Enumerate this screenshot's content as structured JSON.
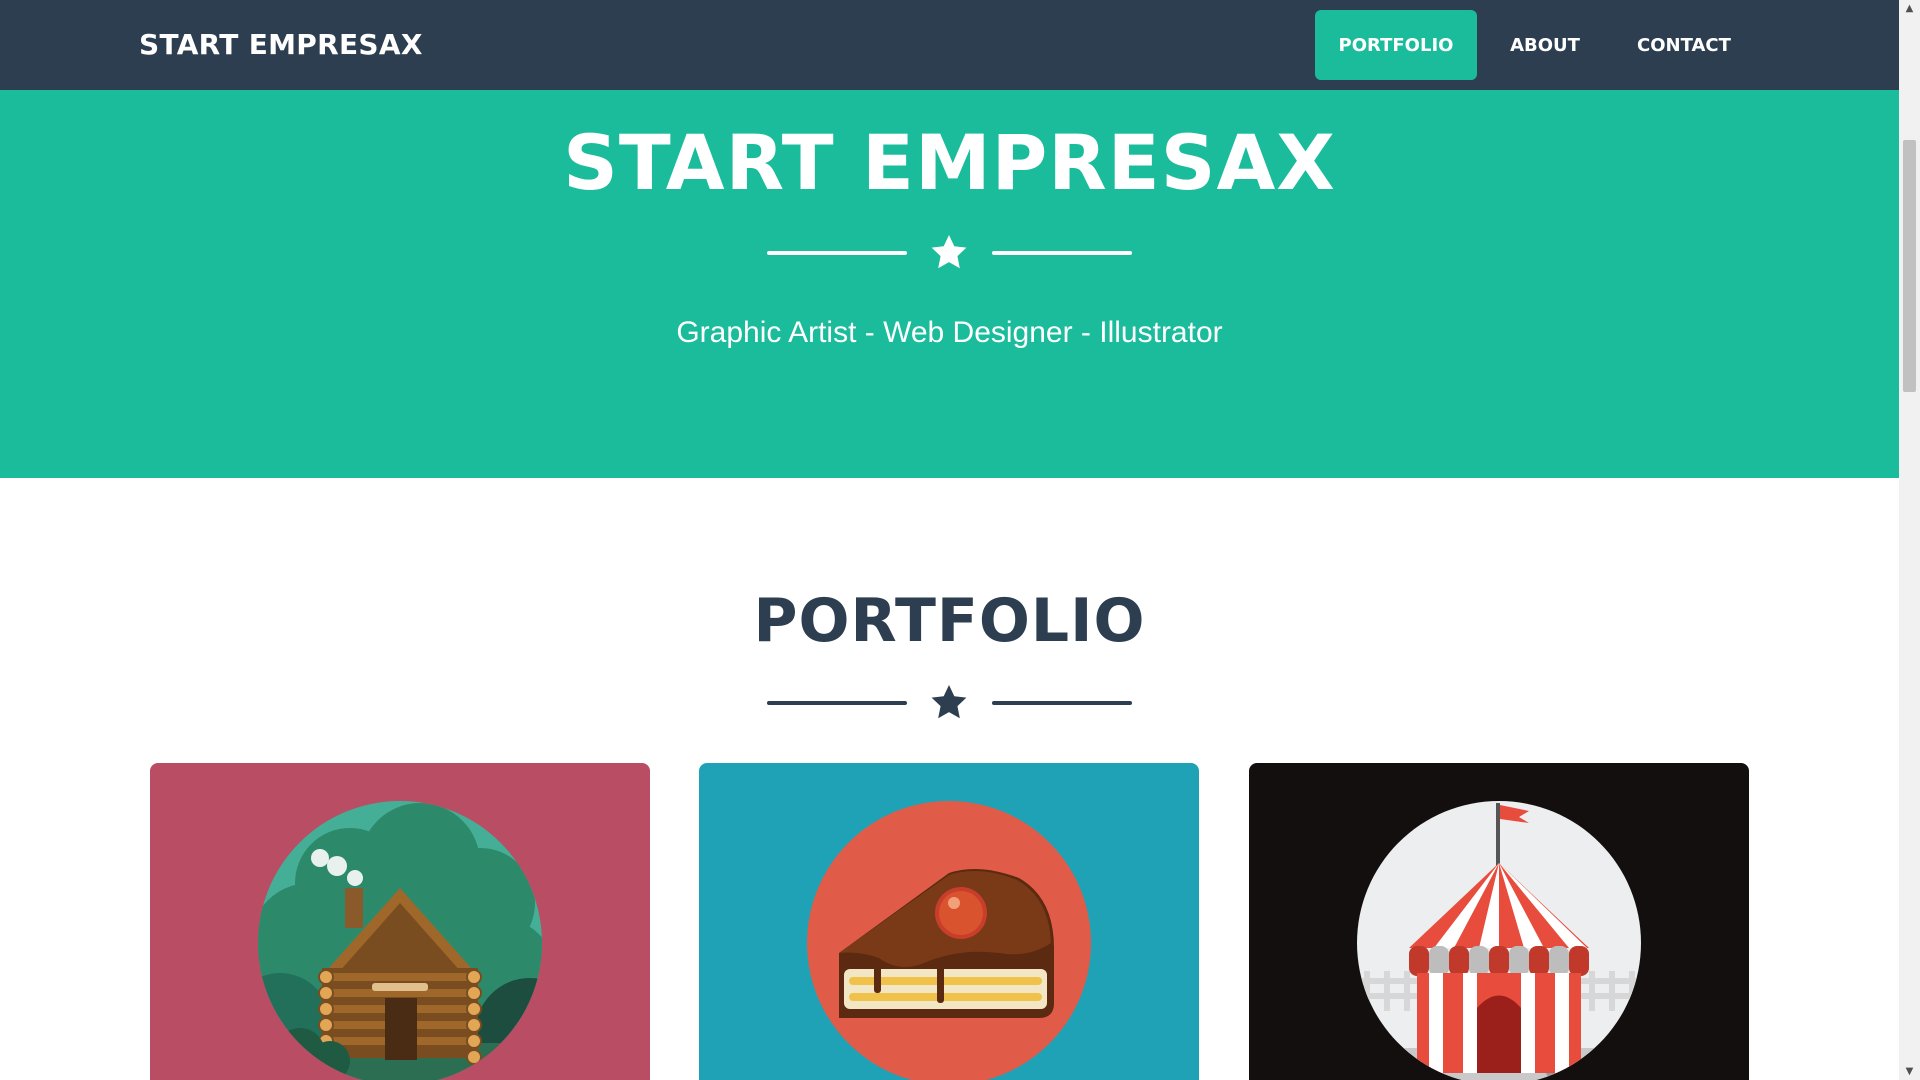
{
  "navbar": {
    "brand": "START EMPRESAX",
    "items": [
      {
        "label": "PORTFOLIO",
        "active": true
      },
      {
        "label": "ABOUT",
        "active": false
      },
      {
        "label": "CONTACT",
        "active": false
      }
    ]
  },
  "hero": {
    "title": "START EMPRESAX",
    "subtitle": "Graphic Artist - Web Designer - Illustrator",
    "icon": "star-icon"
  },
  "portfolio": {
    "title": "PORTFOLIO",
    "icon": "star-icon",
    "items": [
      {
        "name": "cabin",
        "icon": "cabin-icon",
        "background": "#b84d63"
      },
      {
        "name": "cake",
        "icon": "cake-icon",
        "background": "#1fa2b6"
      },
      {
        "name": "circus",
        "icon": "circus-tent-icon",
        "background": "#130f0e"
      }
    ]
  },
  "colors": {
    "navbar": "#2c3e50",
    "accent": "#1abc9c",
    "text_dark": "#2c3e50"
  }
}
